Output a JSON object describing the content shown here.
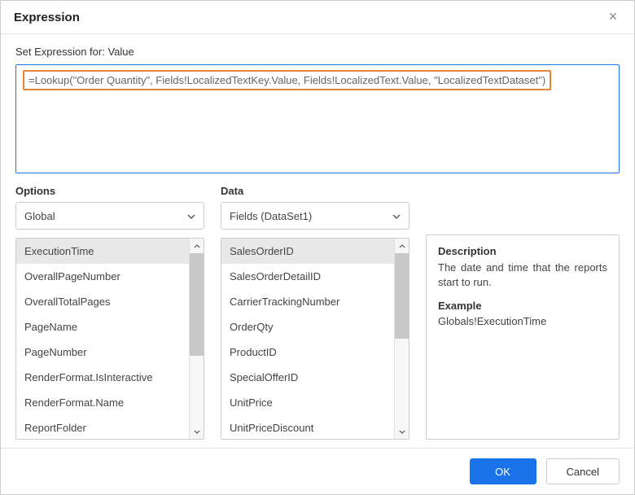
{
  "dialog": {
    "title": "Expression",
    "set_label": "Set Expression for: Value",
    "expression": "=Lookup(\"Order Quantity\", Fields!LocalizedTextKey.Value, Fields!LocalizedText.Value, \"LocalizedTextDataset\")"
  },
  "options": {
    "label": "Options",
    "selected": "Global",
    "items": [
      "ExecutionTime",
      "OverallPageNumber",
      "OverallTotalPages",
      "PageName",
      "PageNumber",
      "RenderFormat.IsInteractive",
      "RenderFormat.Name",
      "ReportFolder"
    ],
    "selectedIndex": 0
  },
  "data": {
    "label": "Data",
    "selected": "Fields (DataSet1)",
    "items": [
      "SalesOrderID",
      "SalesOrderDetailID",
      "CarrierTrackingNumber",
      "OrderQty",
      "ProductID",
      "SpecialOfferID",
      "UnitPrice",
      "UnitPriceDiscount"
    ],
    "selectedIndex": 0
  },
  "info": {
    "description_label": "Description",
    "description_text": "The date and time that the reports start to run.",
    "example_label": "Example",
    "example_text": "Globals!ExecutionTime"
  },
  "footer": {
    "ok": "OK",
    "cancel": "Cancel"
  }
}
